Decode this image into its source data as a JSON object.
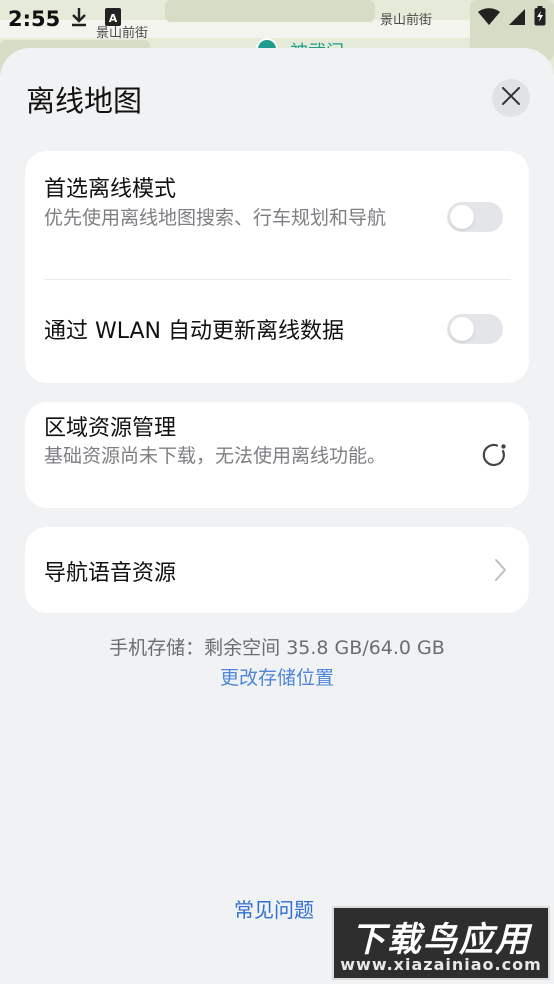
{
  "status_bar": {
    "time": "2:55",
    "icons": [
      "download-icon",
      "app-icon",
      "wifi-icon",
      "cellular-icon",
      "battery-icon"
    ]
  },
  "map": {
    "labels": [
      "景山前街",
      "景山前街",
      "神武门"
    ]
  },
  "sheet": {
    "title": "离线地图",
    "close_icon": "close-icon"
  },
  "settings": {
    "preferred_offline": {
      "title": "首选离线模式",
      "subtitle": "优先使用离线地图搜索、行车规划和导航",
      "enabled": false
    },
    "wlan_auto_update": {
      "title": "通过 WLAN 自动更新离线数据",
      "enabled": false
    },
    "region_resources": {
      "title": "区域资源管理",
      "subtitle": "基础资源尚未下载，无法使用离线功能。",
      "icon": "loading-icon"
    },
    "nav_voice": {
      "title": "导航语音资源",
      "icon": "chevron-right-icon"
    }
  },
  "storage": {
    "text": "手机存储：剩余空间 35.8 GB/64.0 GB",
    "change_link": "更改存储位置"
  },
  "faq": {
    "label": "常见问题"
  },
  "watermark": {
    "title": "下载鸟应用",
    "url": "www.xiazainiao.com"
  },
  "colors": {
    "background": "#f1f2f4",
    "card": "#ffffff",
    "link": "#2e6fd1",
    "toggle_off": "#e4e5e8"
  }
}
